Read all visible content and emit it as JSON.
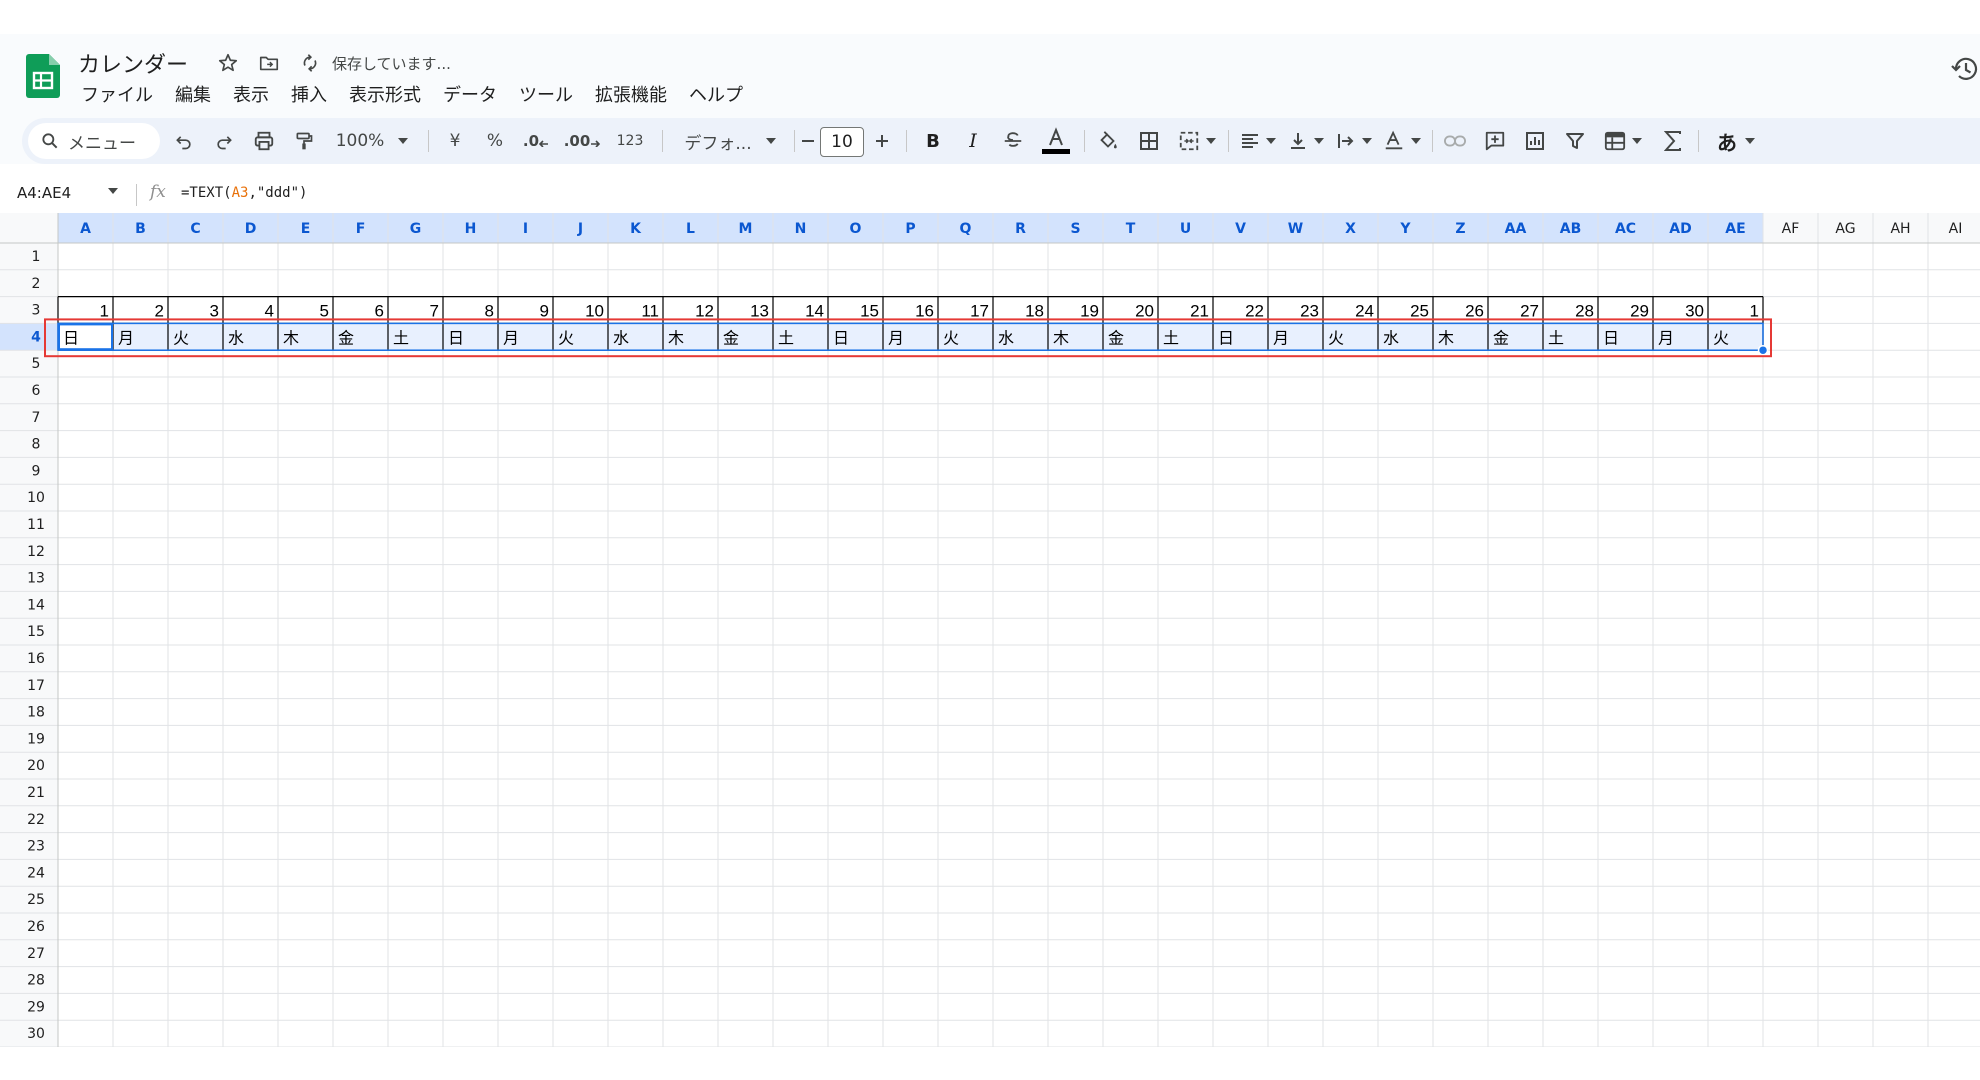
{
  "app": {
    "title": "カレンダー",
    "save_status": "保存しています...",
    "brand_color": "#0f9d58"
  },
  "menu": [
    "ファイル",
    "編集",
    "表示",
    "挿入",
    "表示形式",
    "データ",
    "ツール",
    "拡張機能",
    "ヘルプ"
  ],
  "toolbar": {
    "search_label": "メニュー",
    "zoom": "100%",
    "currency": "¥",
    "percent": "%",
    "decimal_decrease": ".0",
    "decimal_increase": ".00",
    "number_format": "123",
    "font": "デフォ...",
    "font_size": "10",
    "bold": "B",
    "italic": "I",
    "input_mode": "あ",
    "icons": [
      "search-icon",
      "undo-icon",
      "redo-icon",
      "print-icon",
      "paint-format-icon",
      "minus-icon",
      "plus-icon",
      "strikethrough-icon",
      "text-color-icon",
      "fill-color-icon",
      "borders-icon",
      "merge-cells-icon",
      "align-icon",
      "vertical-align-icon",
      "text-wrap-icon",
      "text-rotate-icon",
      "link-icon",
      "comment-icon",
      "chart-icon",
      "filter-icon",
      "filter-views-icon",
      "functions-icon"
    ]
  },
  "formula_bar": {
    "name_box": "A4:AE4",
    "fx": "fx",
    "formula_prefix": "=TEXT(",
    "formula_ref": "A3",
    "formula_suffix": ",\"ddd\")"
  },
  "sheet": {
    "columns": [
      "A",
      "B",
      "C",
      "D",
      "E",
      "F",
      "G",
      "H",
      "I",
      "J",
      "K",
      "L",
      "M",
      "N",
      "O",
      "P",
      "Q",
      "R",
      "S",
      "T",
      "U",
      "V",
      "W",
      "X",
      "Y",
      "Z",
      "AA",
      "AB",
      "AC",
      "AD",
      "AE",
      "AF",
      "AG",
      "AH",
      "AI"
    ],
    "row_count": 30,
    "selected_columns": 31,
    "selected_row": 4,
    "date_row": 3,
    "weekday_row": 4,
    "dates": [
      "1",
      "2",
      "3",
      "4",
      "5",
      "6",
      "7",
      "8",
      "9",
      "10",
      "11",
      "12",
      "13",
      "14",
      "15",
      "16",
      "17",
      "18",
      "19",
      "20",
      "21",
      "22",
      "23",
      "24",
      "25",
      "26",
      "27",
      "28",
      "29",
      "30",
      "1"
    ],
    "weekdays": [
      "日",
      "月",
      "火",
      "水",
      "木",
      "金",
      "土",
      "日",
      "月",
      "火",
      "水",
      "木",
      "金",
      "土",
      "日",
      "月",
      "火",
      "水",
      "木",
      "金",
      "土",
      "日",
      "月",
      "火",
      "水",
      "木",
      "金",
      "土",
      "日",
      "月",
      "火"
    ],
    "colors": {
      "selection_fill": "#e8f0fe",
      "selection_border": "#1a73e8",
      "header_selected": "#d3e3fd",
      "annotation": "#e53935"
    }
  }
}
